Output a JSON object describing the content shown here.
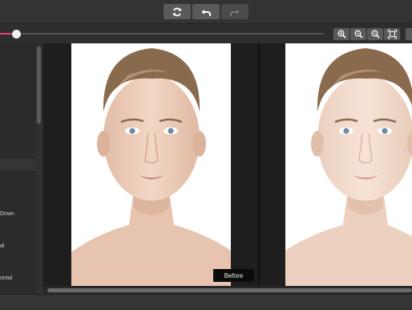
{
  "toolbar": {
    "buttons": [
      {
        "icon": "refresh-icon",
        "enabled": true
      },
      {
        "icon": "undo-icon",
        "enabled": true
      },
      {
        "icon": "redo-icon",
        "enabled": false
      }
    ]
  },
  "slider": {
    "value": 0.05,
    "accent": "#e0457b"
  },
  "zoom": {
    "buttons": [
      "zoom-in-icon",
      "zoom-out-icon",
      "zoom-actual-icon",
      "fit-screen-icon"
    ]
  },
  "left_panel": {
    "items": [
      "Down",
      "al",
      "ontal"
    ]
  },
  "preview": {
    "before_label": "Before"
  },
  "colors": {
    "background": "#2b2b2b",
    "canvas": "#1e1e1e",
    "accent": "#e0457b"
  }
}
